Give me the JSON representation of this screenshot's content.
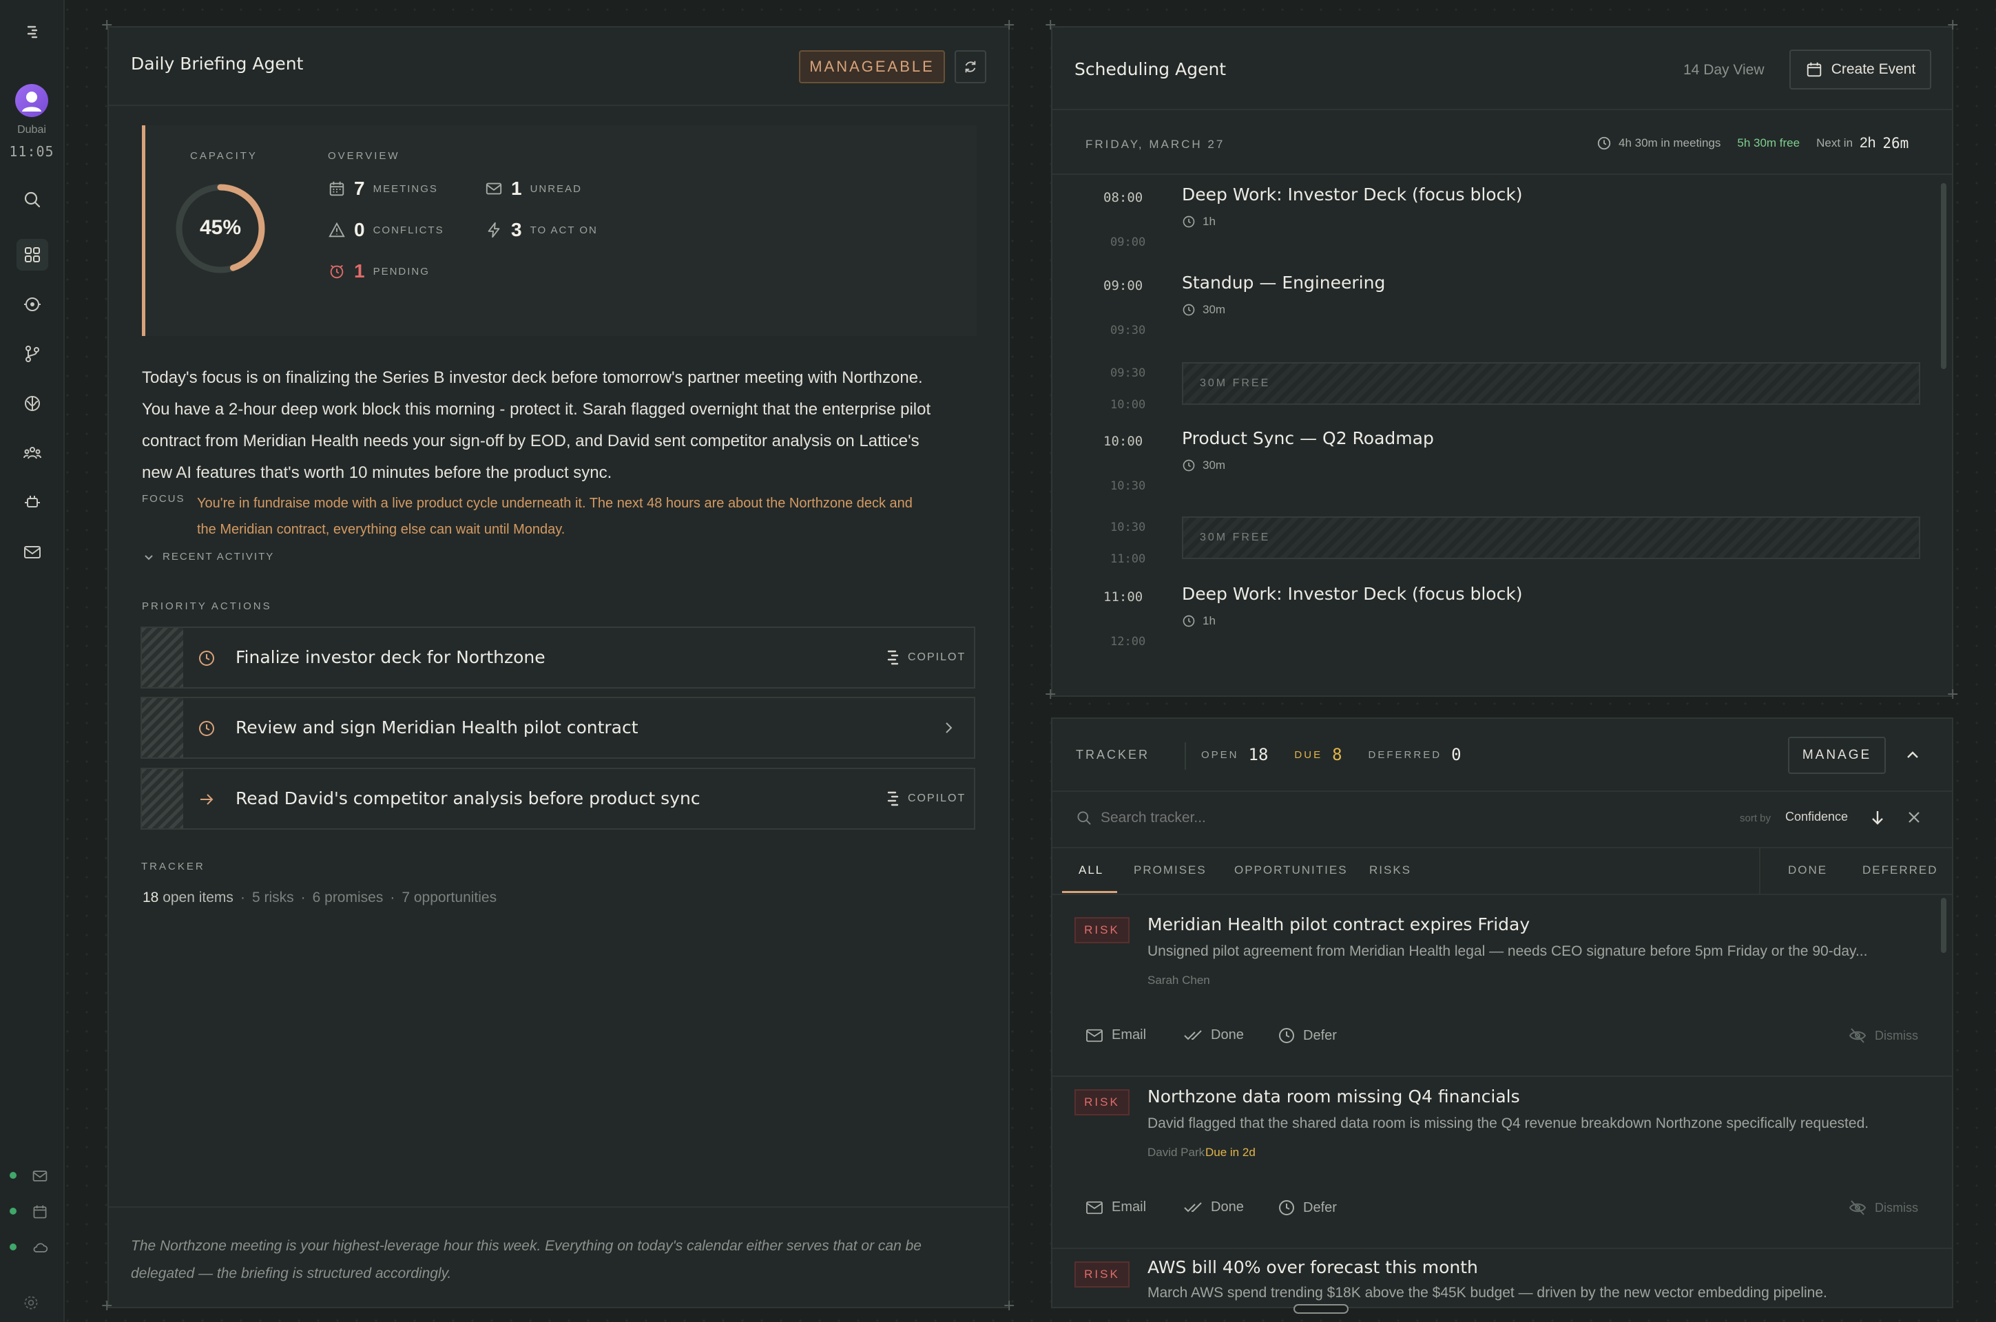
{
  "sidebar": {
    "location": "Dubai",
    "time": "11:05"
  },
  "briefing": {
    "title": "Daily Briefing Agent",
    "status_label": "MANAGEABLE",
    "capacity_label": "CAPACITY",
    "capacity_value": "45%",
    "capacity_fraction": 0.45,
    "overview_label": "OVERVIEW",
    "stats": {
      "meetings": {
        "value": "7",
        "label": "MEETINGS"
      },
      "conflicts": {
        "value": "0",
        "label": "CONFLICTS"
      },
      "pending": {
        "value": "1",
        "label": "PENDING"
      },
      "unread": {
        "value": "1",
        "label": "UNREAD"
      },
      "to_act_on": {
        "value": "3",
        "label": "TO ACT ON"
      }
    },
    "summary": {
      "line1": "Today's focus is on finalizing the Series B investor deck before tomorrow's partner meeting with Northzone.",
      "line2": "You have a 2-hour deep work block this morning - protect it. Sarah flagged overnight that the enterprise pilot",
      "line3": "contract from Meridian Health needs your sign-off by EOD, and David sent competitor analysis on Lattice's",
      "line4": "new AI features that's worth 10 minutes before the product sync."
    },
    "focus_label": "FOCUS",
    "focus_line1": "You're in fundraise mode with a live product cycle underneath it. The next 48 hours are about the Northzone deck and",
    "focus_line2": "the Meridian contract, everything else can wait until Monday.",
    "recent_activity_label": "RECENT ACTIVITY",
    "priority_label": "PRIORITY ACTIONS",
    "priority_actions": [
      {
        "title": "Finalize investor deck for Northzone",
        "tag": "COPILOT"
      },
      {
        "title": "Review and sign Meridian Health pilot contract"
      },
      {
        "title": "Read David's competitor analysis before product sync",
        "tag": "COPILOT"
      }
    ],
    "tracker_label": "TRACKER",
    "tracker_open": "18",
    "tracker_open_label": "open items",
    "tracker_risks": "5 risks",
    "tracker_promises": "6 promises",
    "tracker_opps": "7 opportunities",
    "footer_line1": "The Northzone meeting is your highest-leverage hour this week. Everything on today's calendar either serves that or can be",
    "footer_line2": "delegated — the briefing is structured accordingly."
  },
  "scheduling": {
    "title": "Scheduling Agent",
    "view_label": "14 Day View",
    "create_label": "Create Event",
    "date_label": "FRIDAY, MARCH 27",
    "in_meetings": "4h 30m in meetings",
    "free_time": "5h 30m free",
    "next_label": "Next in",
    "next_h": "2h",
    "next_m": "26m",
    "slots": [
      {
        "start": "08:00",
        "end": "09:00",
        "title": "Deep Work: Investor Deck (focus block)",
        "duration": "1h"
      },
      {
        "start": "09:00",
        "end": "09:30",
        "title": "Standup — Engineering",
        "duration": "30m"
      },
      {
        "start": "09:30",
        "end": "10:00",
        "free": "30M FREE"
      },
      {
        "start": "10:00",
        "end": "10:30",
        "title": "Product Sync — Q2 Roadmap",
        "duration": "30m"
      },
      {
        "start": "10:30",
        "end": "11:00",
        "free": "30M FREE"
      },
      {
        "start": "11:00",
        "end": "12:00",
        "title": "Deep Work: Investor Deck (focus block)",
        "duration": "1h"
      }
    ]
  },
  "tracker": {
    "label": "TRACKER",
    "open_label": "OPEN",
    "open_value": "18",
    "due_label": "DUE",
    "due_value": "8",
    "deferred_label": "DEFERRED",
    "deferred_value": "0",
    "manage_label": "MANAGE",
    "search_placeholder": "Search tracker...",
    "sort_label": "sort by",
    "sort_value": "Confidence",
    "tabs": {
      "all": "ALL",
      "promises": "PROMISES",
      "opportunities": "OPPORTUNITIES",
      "risks": "RISKS",
      "done": "DONE",
      "deferred": "DEFERRED"
    },
    "actions": {
      "email": "Email",
      "done": "Done",
      "defer": "Defer",
      "dismiss": "Dismiss"
    },
    "items": [
      {
        "badge": "RISK",
        "title": "Meridian Health pilot contract expires Friday",
        "desc": "Unsigned pilot agreement from Meridian Health legal — needs CEO signature before 5pm Friday or the 90-day...",
        "person": "Sarah Chen"
      },
      {
        "badge": "RISK",
        "title": "Northzone data room missing Q4 financials",
        "desc": "David flagged that the shared data room is missing the Q4 revenue breakdown Northzone specifically requested.",
        "person": "David Park",
        "due": "Due in 2d"
      },
      {
        "badge": "RISK",
        "title": "AWS bill 40% over forecast this month",
        "desc": "March AWS spend trending $18K above the $45K budget — driven by the new vector embedding pipeline."
      }
    ]
  },
  "colors": {
    "accent_orange": "#d9a27a",
    "focus_orange": "#d59a63",
    "free_green": "#7fcf8f",
    "due_amber": "#e3b54a",
    "risk_red": "#e36b6b"
  }
}
